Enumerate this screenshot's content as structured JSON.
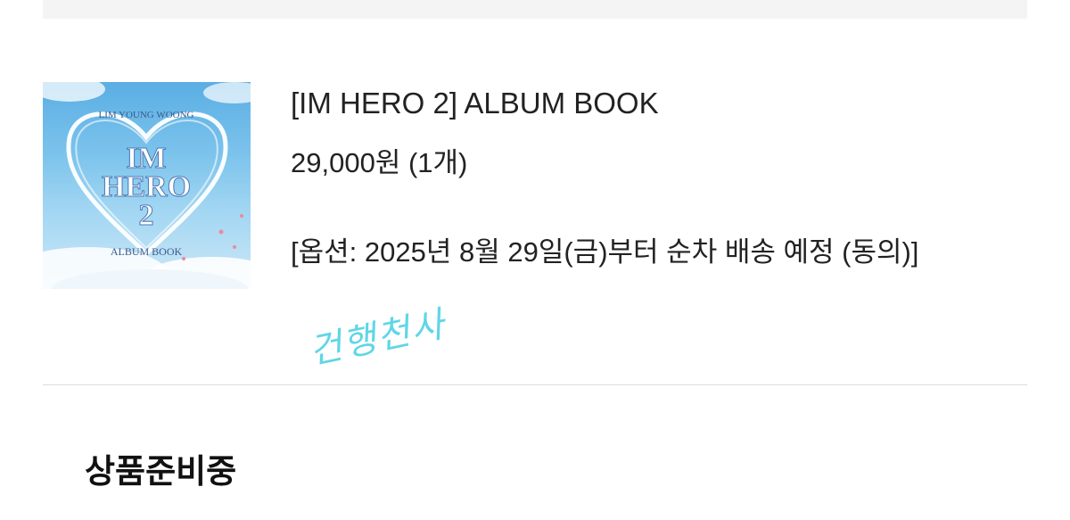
{
  "order_item": {
    "thumbnail": {
      "artist_text": "LIM YOUNG WOONG",
      "title_line1": "IM",
      "title_line2": "HERO",
      "title_line3": "2",
      "subtitle": "ALBUM BOOK",
      "sky_color": "#7cc3ec",
      "heart_color": "#ffffff"
    },
    "title": "[IM HERO 2] ALBUM BOOK",
    "price": "29,000원 (1개)",
    "option": "[옵션: 2025년 8월 29일(금)부터 순차 배송 예정 (동의)]"
  },
  "annotation": {
    "handwritten_text": "건행천사",
    "color": "#5fd6e6"
  },
  "status": {
    "title": "상품준비중"
  }
}
